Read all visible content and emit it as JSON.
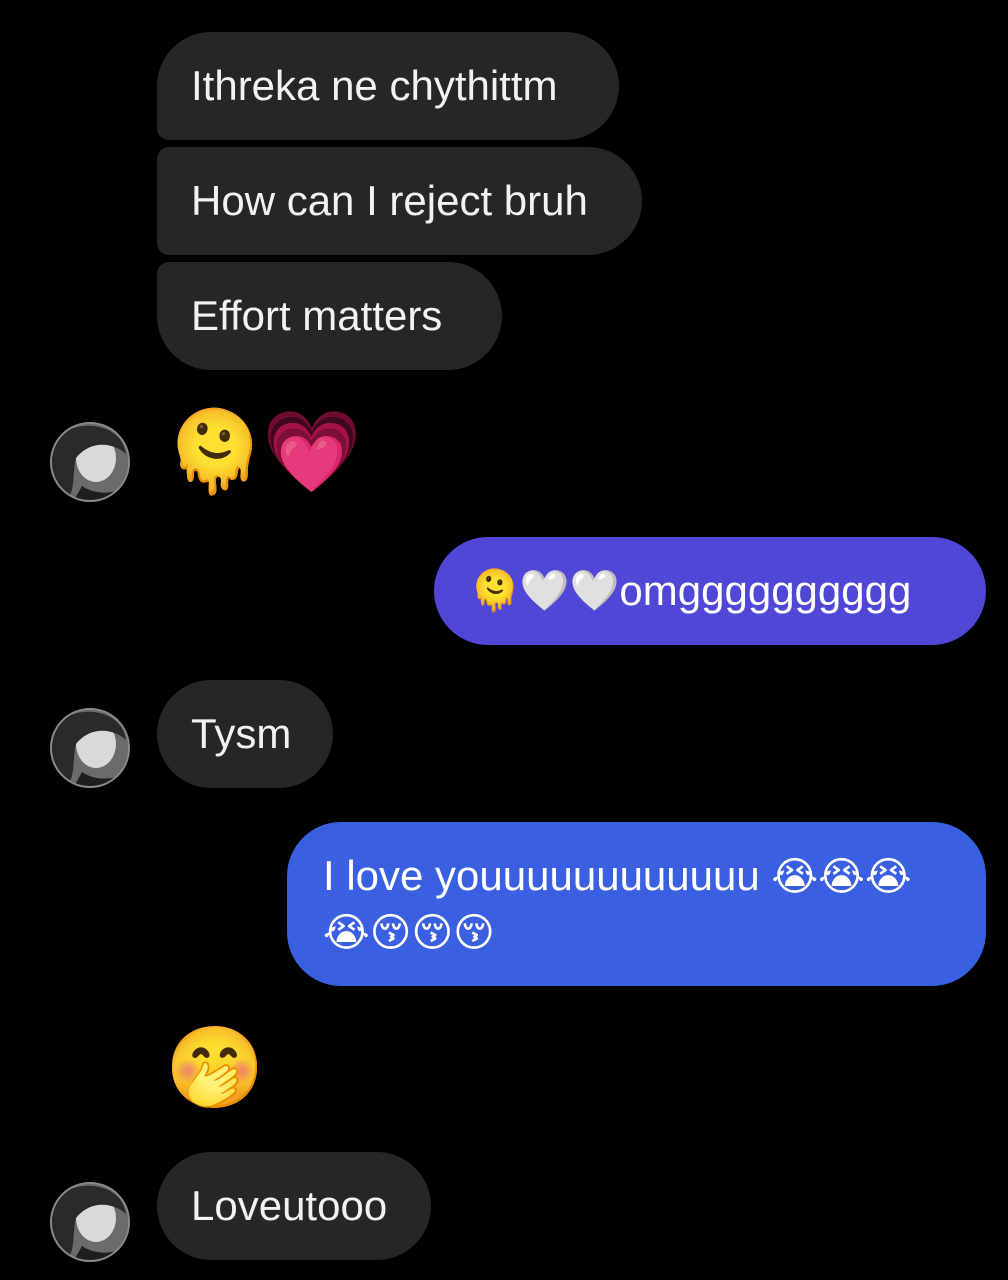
{
  "messages": {
    "m1": "Ithreka ne chythittm",
    "m2": "How can I reject bruh",
    "m3": "Effort matters",
    "reaction_emojis": [
      "🫠",
      "💗"
    ],
    "out1": {
      "emoji": "🫠🤍🤍",
      "text": "omgggggggggg"
    },
    "m4": "Tysm",
    "out2": {
      "line1_text": "I love youuuuuuuuuuuu",
      "line1_emoji": "😭😭😭",
      "line2_emoji": "😭😚😚😚"
    },
    "reaction_emoji_2": "🤭",
    "m5": "Loveutooo"
  },
  "colors": {
    "background": "#000000",
    "incoming_bubble": "#262626",
    "outgoing_bubble_1": "#5147d6",
    "outgoing_bubble_2": "#3a5fe0"
  },
  "icons": {
    "avatar": "contact-avatar-icon"
  }
}
